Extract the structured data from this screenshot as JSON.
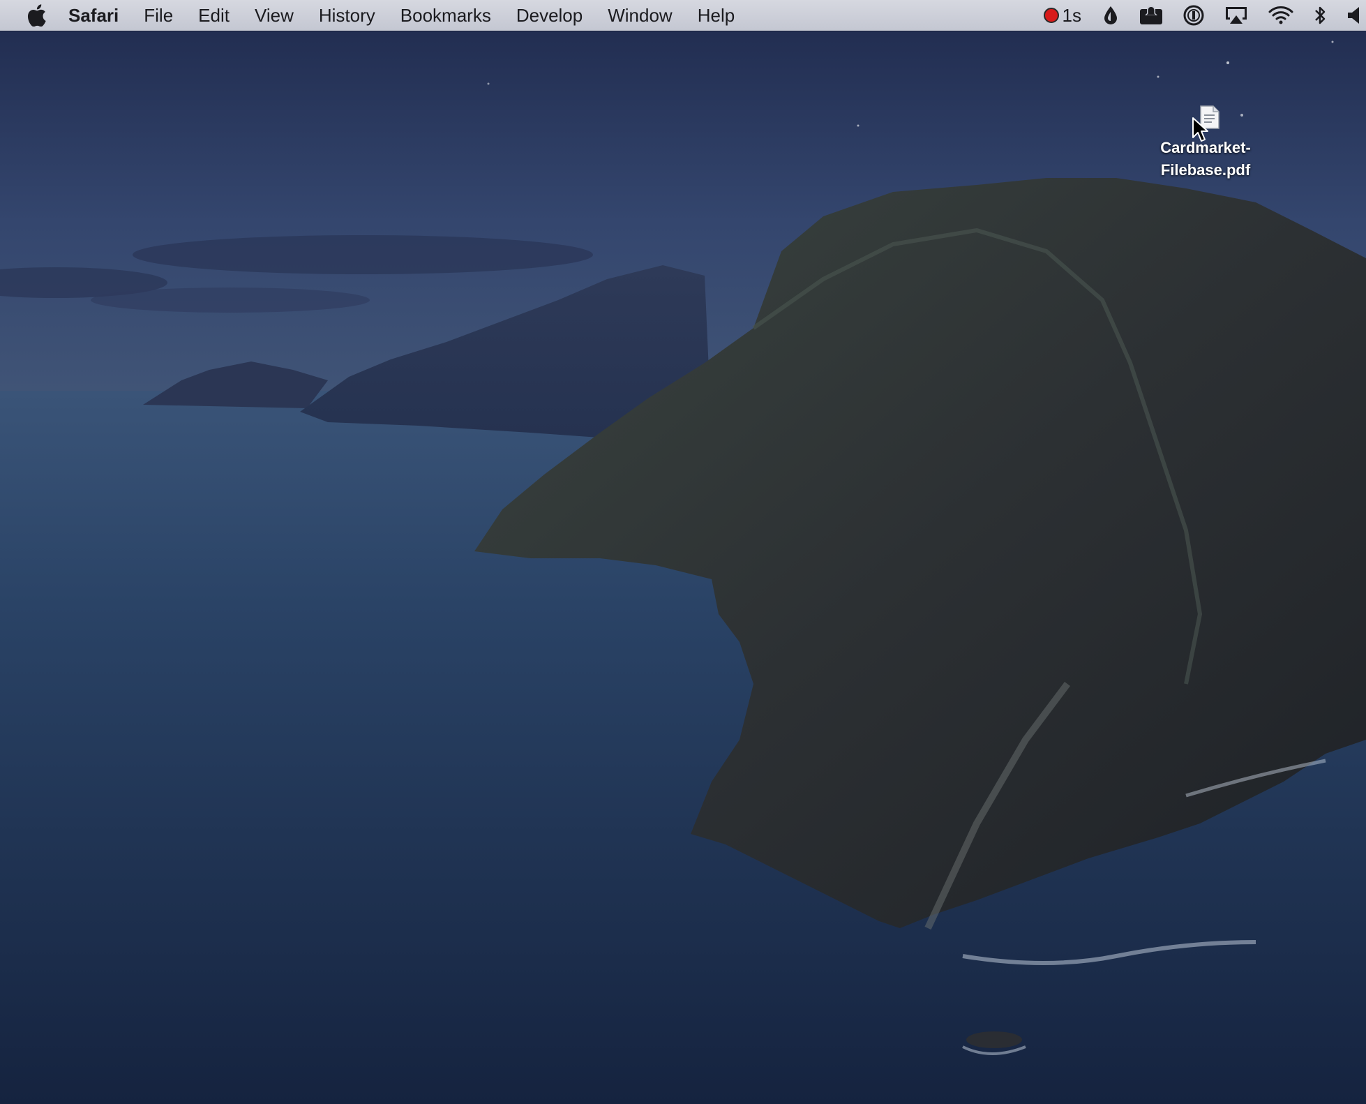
{
  "menubar": {
    "app_name": "Safari",
    "items": [
      "File",
      "Edit",
      "View",
      "History",
      "Bookmarks",
      "Develop",
      "Window",
      "Help"
    ],
    "status": {
      "recording_time": "1s",
      "icons": [
        "recording-icon",
        "drop-icon",
        "notification-icon",
        "password-icon",
        "airplay-icon",
        "wifi-icon",
        "bluetooth-icon",
        "volume-icon"
      ]
    }
  },
  "desktop": {
    "file": {
      "name_line1": "Cardmarket-",
      "name_line2": "Filebase.pdf",
      "icon": "pdf-file-icon"
    }
  },
  "colors": {
    "menubar_bg": "#c9ccd6",
    "record_red": "#d81a1a",
    "sky": "#2a3a5e",
    "sea": "#1d3557"
  }
}
